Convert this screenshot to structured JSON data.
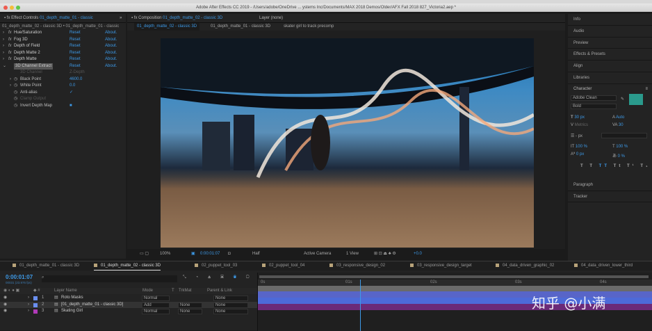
{
  "window": {
    "title": "Adobe After Effects CC 2019 - /Users/adobe/OneDrive ... ystems Inc/Documents/MAX 2018 Demos/Older/AFX Fall 2018 827_Victoria2.aep *"
  },
  "effect_controls": {
    "header_label": "Effect Controls",
    "header_comp": "01_depth_matte_01 - classic",
    "breadcrumb": "01_depth_matte_02 - classic 3D • 01_depth_matte_01 - classic",
    "effects": [
      {
        "name": "Hue/Saturation",
        "reset": "Reset",
        "about": "About."
      },
      {
        "name": "Fog 3D",
        "reset": "Reset",
        "about": "About."
      },
      {
        "name": "Depth of Field",
        "reset": "Reset",
        "about": "About."
      },
      {
        "name": "Depth Matte 2",
        "reset": "Reset",
        "about": "About."
      },
      {
        "name": "Depth Matte",
        "reset": "Reset",
        "about": "About."
      },
      {
        "name": "3D Channel Extract",
        "reset": "Reset",
        "about": "About."
      }
    ],
    "props": [
      {
        "name": "3D Channel",
        "value": "Z-Depth"
      },
      {
        "name": "Black Point",
        "value": "4600.0"
      },
      {
        "name": "White Point",
        "value": "0.0"
      },
      {
        "name": "Anti-alias",
        "value": "✓"
      },
      {
        "name": "Clamp Output",
        "value": ""
      },
      {
        "name": "Invert Depth Map",
        "value": "■"
      }
    ]
  },
  "composition": {
    "header_label": "Composition",
    "header_comp": "01_depth_matte_02 - classic 3D",
    "layer_label": "Layer (none)",
    "breadcrumbs": [
      "01_depth_matte_02 - classic 3D",
      "01_depth_matte_01 - classic 3D",
      "skater girl to track precomp"
    ],
    "toolbar": {
      "zoom": "100%",
      "timecode": "0:00:01:07",
      "resolution": "Half",
      "camera": "Active Camera",
      "views": "1 View",
      "exposure": "+0.0"
    }
  },
  "right_panel": {
    "items": [
      "Info",
      "Audio",
      "Preview",
      "Effects & Presets",
      "Align",
      "Libraries"
    ],
    "character": {
      "title": "Character",
      "font": "Adobe Clean",
      "style": "Bold",
      "size": "30 px",
      "leading": "Auto",
      "kerning": "Metrics",
      "tracking": "30",
      "stroke": "- px",
      "vscale": "100 %",
      "hscale": "100 %",
      "baseline": "0 px",
      "tsume": "0 %",
      "fill_color": "#2a9a8c"
    },
    "bottom_items": [
      "Paragraph",
      "Tracker"
    ]
  },
  "timeline": {
    "tabs": [
      "01_depth_matte_01 - classic 3D",
      "01_depth_matte_02 - classic 3D",
      "02_puppet_tool_03",
      "02_puppet_tool_04",
      "03_responsive_design_02",
      "03_responsive_design_target",
      "04_data_driven_graphic_02",
      "04_data_driven_lower_third"
    ],
    "timecode": "0:00:01:07",
    "frames": "00031 (23.976 fps)",
    "columns": {
      "name": "Layer Name",
      "mode": "Mode",
      "t": "T",
      "trkmat": "TrkMat",
      "parent": "Parent & Link"
    },
    "layers": [
      {
        "num": "1",
        "name": "Roto Masks",
        "mode": "Normal",
        "trkmat": "",
        "parent": "None",
        "color": "#6a8ff0"
      },
      {
        "num": "2",
        "name": "[01_depth_matte_01 - classic 3D]",
        "mode": "Add",
        "trkmat": "None",
        "parent": "None",
        "color": "#6a8ff0"
      },
      {
        "num": "3",
        "name": "Skating Girl",
        "mode": "Normal",
        "trkmat": "None",
        "parent": "None",
        "color": "#b03ab8"
      }
    ],
    "ruler": [
      "0s",
      "01s",
      "02s",
      "03s",
      "04s"
    ],
    "playhead_seconds": 1.3
  },
  "watermark": "知乎 @小满"
}
